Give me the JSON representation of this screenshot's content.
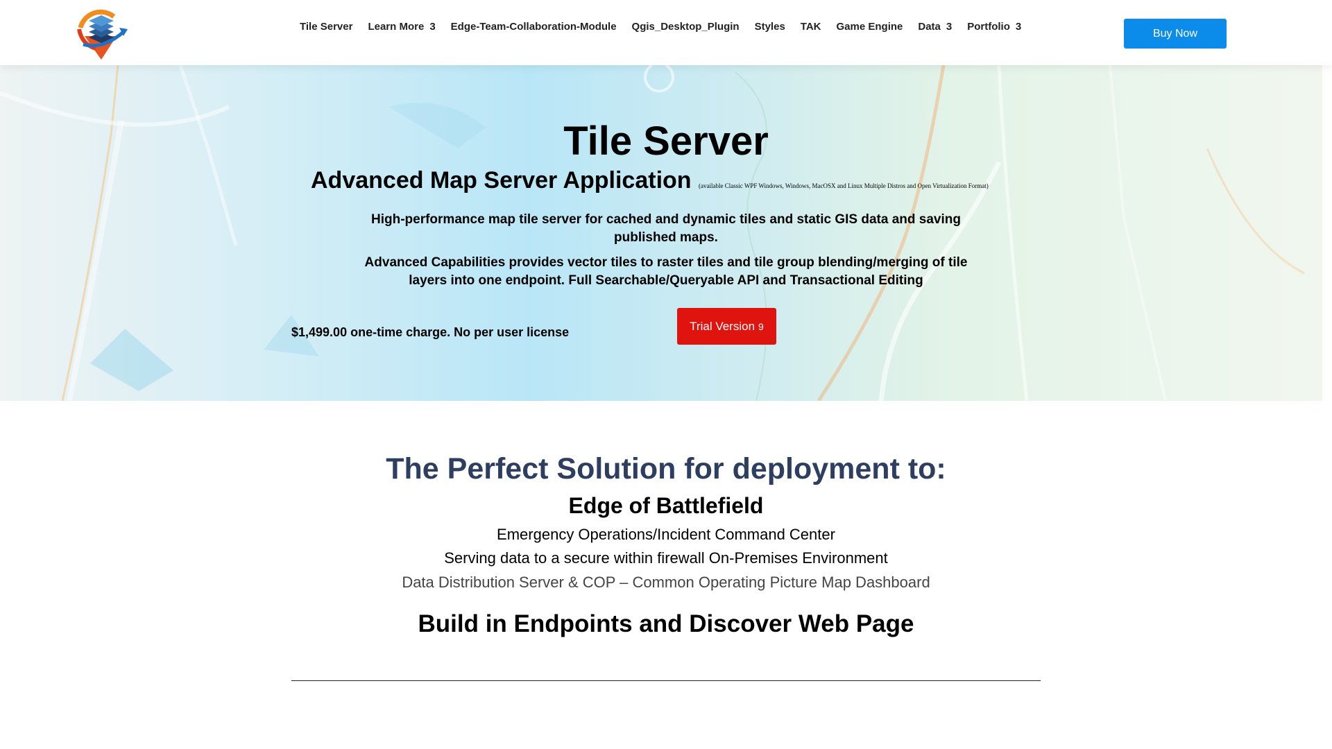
{
  "header": {
    "nav": [
      {
        "label": "Tile Server",
        "has_dropdown": false
      },
      {
        "label": "Learn More",
        "has_dropdown": true
      },
      {
        "label": "Edge-Team-Collaboration-Module",
        "has_dropdown": false
      },
      {
        "label": "Qgis_Desktop_Plugin",
        "has_dropdown": false
      },
      {
        "label": "Styles",
        "has_dropdown": false
      },
      {
        "label": "TAK",
        "has_dropdown": false
      },
      {
        "label": "Game Engine",
        "has_dropdown": false
      },
      {
        "label": "Data",
        "has_dropdown": true
      },
      {
        "label": "Portfolio",
        "has_dropdown": true
      }
    ],
    "dropdown_glyph": "3",
    "buy_label": "Buy Now"
  },
  "hero": {
    "title": "Tile Server",
    "subtitle": "Advanced Map Server Application",
    "platform_note": "(available Classic WPF Windows, Windows, MacOSX and Linux Multiple Distros and Open Virtualization Format)",
    "para1": "High-performance map tile server for cached and dynamic tiles and static GIS data and saving published maps.",
    "para2": "Advanced Capabilities provides vector tiles to raster tiles and tile group blending/merging of tile layers into one endpoint.  Full Searchable/Queryable API and Transactional Editing",
    "price": "$1,499.00 one-time charge. No per user license",
    "trial_label": "Trial Version",
    "trial_count": "9"
  },
  "section": {
    "title": "The Perfect Solution for deployment to:",
    "edge": "Edge of Battlefield",
    "line1": "Emergency Operations/Incident Command Center",
    "line2": "Serving data to a secure within firewall On-Premises Environment",
    "line3": "Data Distribution Server & COP – Common Operating Picture Map Dashboard",
    "endpoints": "Build in Endpoints and Discover Web Page"
  },
  "colors": {
    "buy_button": "#0c8cea",
    "trial_button": "#e0140e",
    "section_title": "#2e3e60"
  },
  "icons": {
    "logo": "stacked-layers-map-pin-logo-icon",
    "dropdown": "chevron-down-icon"
  }
}
